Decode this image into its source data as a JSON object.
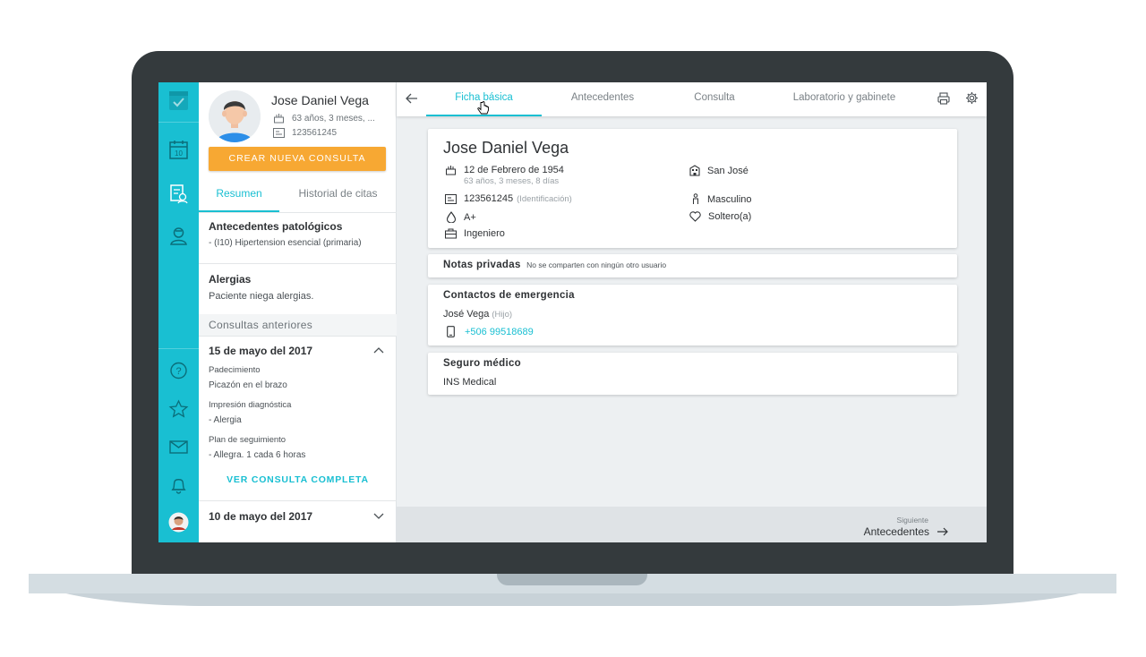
{
  "colors": {
    "accent": "#19bfd2",
    "cta": "#f7a833"
  },
  "rail": {
    "top_icons": [
      "checklist-icon",
      "calendar-icon",
      "patient-record-icon",
      "doctor-icon"
    ],
    "calendar_day": "10",
    "bottom_icons": [
      "help-icon",
      "star-icon",
      "mail-icon",
      "bell-icon",
      "user-avatar"
    ]
  },
  "patient": {
    "name": "Jose Daniel Vega",
    "age": "63 años, 3 meses, ...",
    "id": "123561245",
    "cta": "CREAR NUEVA CONSULTA",
    "tabs": [
      "Resumen",
      "Historial de citas"
    ],
    "antecedentes_title": "Antecedentes patológicos",
    "antecedentes_item": "- (I10) Hipertension esencial (primaria)",
    "alergias_title": "Alergias",
    "alergias_text": "Paciente niega alergias.",
    "consultas_title": "Consultas anteriores",
    "consultas": [
      {
        "date": "15 de mayo del 2017",
        "padecimiento_label": "Padecimiento",
        "padecimiento": "Picazón en el brazo",
        "impresion_label": "Impresión diagnóstica",
        "impresion": "- Alergia",
        "plan_label": "Plan de seguimiento",
        "plan": "- Allegra. 1 cada 6 horas",
        "link": "VER CONSULTA COMPLETA"
      },
      {
        "date": "10 de mayo del 2017"
      }
    ]
  },
  "topbar": {
    "tabs": [
      "Ficha básica",
      "Antecedentes",
      "Consulta",
      "Laboratorio y gabinete"
    ],
    "active_tab": "Ficha básica"
  },
  "ficha": {
    "name": "Jose Daniel Vega",
    "birthdate": "12 de Febrero de 1954",
    "age": "63 años, 3 meses, 8 días",
    "id": "123561245",
    "id_label": "(Identificación)",
    "blood": "A+",
    "occupation": "Ingeniero",
    "location": "San José",
    "gender": "Masculino",
    "civil": "Soltero(a)"
  },
  "notas": {
    "title": "Notas privadas",
    "hint": "No se comparten con ningún otro usuario"
  },
  "contactos": {
    "title": "Contactos de emergencia",
    "name": "José Vega",
    "relation": "(Hijo)",
    "phone": "+506 99518689"
  },
  "seguro": {
    "title": "Seguro médico",
    "value": "INS Medical"
  },
  "footer": {
    "label": "Siguiente",
    "value": "Antecedentes"
  }
}
